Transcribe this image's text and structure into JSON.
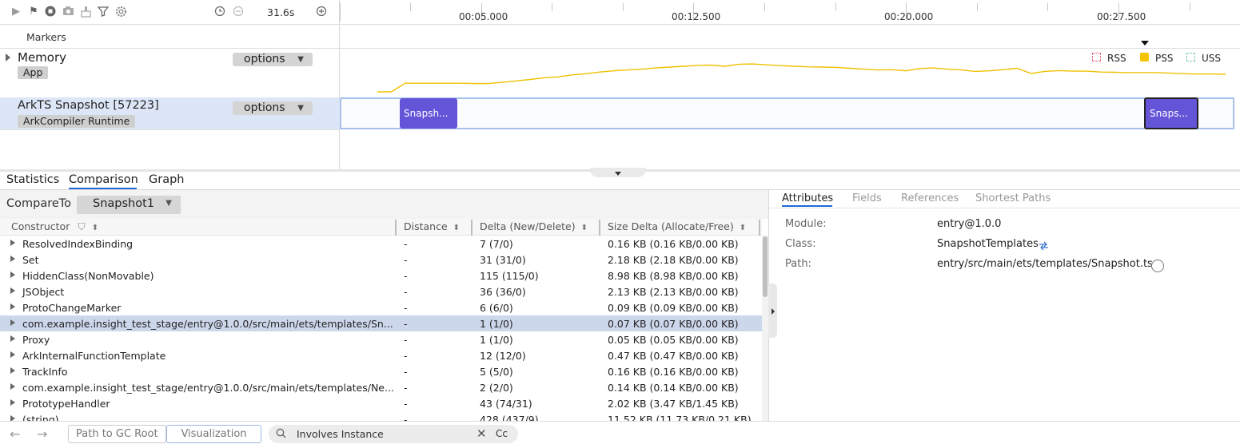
{
  "toolbar": {
    "duration": "31.6s",
    "icons": [
      "play-icon",
      "flag-icon",
      "stop-icon",
      "camera-icon",
      "clean-icon",
      "filter-icon",
      "gear-icon",
      "clock-icon",
      "minus-icon",
      "plus-icon"
    ]
  },
  "ruler": {
    "labels": [
      "00:05.000",
      "00:12.500",
      "00:20.000",
      "00:27.500"
    ]
  },
  "tracks": {
    "markers_label": "Markers",
    "memory": {
      "title": "Memory",
      "tag": "App",
      "options": "options"
    },
    "snapshot": {
      "title": "ArkTS Snapshot [57223]",
      "tag": "ArkCompiler Runtime",
      "options": "options"
    }
  },
  "legend": {
    "rss": "RSS",
    "pss": "PSS",
    "uss": "USS",
    "pss_color": "#f5c400"
  },
  "snapshots": [
    "Snapsh...",
    "Snaps..."
  ],
  "chart_data": {
    "type": "line",
    "series": [
      {
        "name": "PSS",
        "color": "#f0c000",
        "values": [
          0,
          0,
          3,
          3,
          3,
          3,
          3,
          2.9,
          2.9,
          3.3,
          3.8,
          4.3,
          4.9,
          5.2,
          5.9,
          6.3,
          6.9,
          7.3,
          7.6,
          7.9,
          8.3,
          8.6,
          8.9,
          9.2,
          9.3,
          8.9,
          9.6,
          9.7,
          9.4,
          9.1,
          8.9,
          8.7,
          8.6,
          8.5,
          8.2,
          7.9,
          7.6,
          7.7,
          7.3,
          8.1,
          8.3,
          7.9,
          7.6,
          7.1,
          7.3,
          7.7,
          8.2,
          6.4,
          7.1,
          7.4,
          7.2,
          7.2,
          6.9,
          6.8,
          6.7,
          6.7,
          6.7,
          6.5,
          6.3,
          6.2,
          6.2,
          6.1
        ]
      }
    ]
  },
  "bottom_tabs": {
    "statistics": "Statistics",
    "comparison": "Comparison",
    "graph": "Graph"
  },
  "compare": {
    "label": "CompareTo",
    "selected": "Snapshot1"
  },
  "table": {
    "headers": {
      "constructor": "Constructor",
      "distance": "Distance",
      "delta": "Delta (New/Delete)",
      "size_delta": "Size Delta (Allocate/Free)"
    },
    "rows": [
      {
        "name": "ResolvedIndexBinding",
        "distance": "-",
        "delta": "7 (7/0)",
        "size": "0.16 KB (0.16 KB/0.00 KB)"
      },
      {
        "name": "Set",
        "distance": "-",
        "delta": "31 (31/0)",
        "size": "2.18 KB (2.18 KB/0.00 KB)"
      },
      {
        "name": "HiddenClass(NonMovable)",
        "distance": "-",
        "delta": "115 (115/0)",
        "size": "8.98 KB (8.98 KB/0.00 KB)"
      },
      {
        "name": "JSObject",
        "distance": "-",
        "delta": "36 (36/0)",
        "size": "2.13 KB (2.13 KB/0.00 KB)"
      },
      {
        "name": "ProtoChangeMarker",
        "distance": "-",
        "delta": "6 (6/0)",
        "size": "0.09 KB (0.09 KB/0.00 KB)"
      },
      {
        "name": "com.example.insight_test_stage/entry@1.0.0/src/main/ets/templates/Sn...",
        "distance": "-",
        "delta": "1 (1/0)",
        "size": "0.07 KB (0.07 KB/0.00 KB)"
      },
      {
        "name": "Proxy",
        "distance": "-",
        "delta": "1 (1/0)",
        "size": "0.05 KB (0.05 KB/0.00 KB)"
      },
      {
        "name": "ArkInternalFunctionTemplate",
        "distance": "-",
        "delta": "12 (12/0)",
        "size": "0.47 KB (0.47 KB/0.00 KB)"
      },
      {
        "name": "TrackInfo",
        "distance": "-",
        "delta": "5 (5/0)",
        "size": "0.16 KB (0.16 KB/0.00 KB)"
      },
      {
        "name": "com.example.insight_test_stage/entry@1.0.0/src/main/ets/templates/Ne...",
        "distance": "-",
        "delta": "2 (2/0)",
        "size": "0.14 KB (0.14 KB/0.00 KB)"
      },
      {
        "name": "PrototypeHandler",
        "distance": "-",
        "delta": "43 (74/31)",
        "size": "2.02 KB (3.47 KB/1.45 KB)"
      },
      {
        "name": "(string)",
        "distance": "-",
        "delta": "428 (437/9)",
        "size": "11.52 KB (11.73 KB/0.21 KB)"
      }
    ]
  },
  "details": {
    "tabs": {
      "attributes": "Attributes",
      "fields": "Fields",
      "references": "References",
      "shortest_paths": "Shortest Paths"
    },
    "module_label": "Module:",
    "module_value": "entry@1.0.0",
    "class_label": "Class:",
    "class_value": "SnapshotTemplates",
    "path_label": "Path:",
    "path_value": "entry/src/main/ets/templates/Snapshot.ts"
  },
  "bottom_bar": {
    "path_to_gc": "Path to GC Root",
    "visualization": "Visualization",
    "search_value": "Involves Instance",
    "case_toggle": "Cc"
  }
}
